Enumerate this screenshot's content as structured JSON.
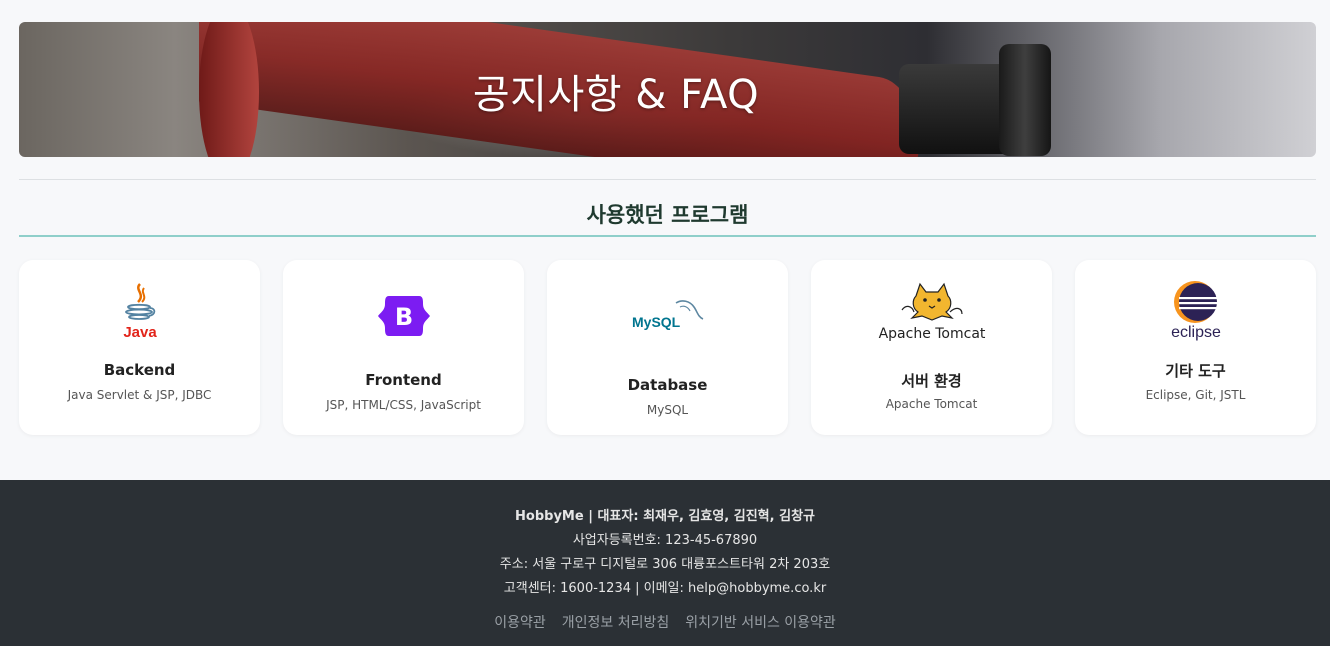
{
  "banner": {
    "title": "공지사항 & FAQ"
  },
  "section": {
    "title": "사용했던 프로그램"
  },
  "cards": [
    {
      "logo": "java-logo",
      "logo_text": "Java",
      "title": "Backend",
      "desc": "Java Servlet & JSP, JDBC"
    },
    {
      "logo": "bootstrap-logo",
      "logo_text": "B",
      "title": "Frontend",
      "desc": "JSP, HTML/CSS, JavaScript"
    },
    {
      "logo": "mysql-logo",
      "logo_text": "MySQL",
      "title": "Database",
      "desc": "MySQL"
    },
    {
      "logo": "tomcat-logo",
      "logo_text": "Apache Tomcat",
      "title": "서버 환경",
      "desc": "Apache Tomcat"
    },
    {
      "logo": "eclipse-logo",
      "logo_text": "eclipse",
      "title": "기타 도구",
      "desc": "Eclipse, Git, JSTL"
    }
  ],
  "footer": {
    "company": "HobbyMe | 대표자: 최재우, 김효영, 김진혁, 김창규",
    "biz_number": "사업자등록번호: 123-45-67890",
    "address": "주소: 서울 구로구 디지털로 306 대륭포스트타워 2차 203호",
    "contact": "고객센터: 1600-1234 | 이메일: help@hobbyme.co.kr",
    "links": [
      "이용약관",
      "개인정보 처리방침",
      "위치기반 서비스 이용약관"
    ]
  },
  "colors": {
    "background": "#f7f8fa",
    "footer_bg": "#2b3035",
    "section_underline": "#8fcfca",
    "bootstrap_purple": "#7c1cf2",
    "java_red": "#e76f00",
    "java_blue": "#5382a1"
  }
}
